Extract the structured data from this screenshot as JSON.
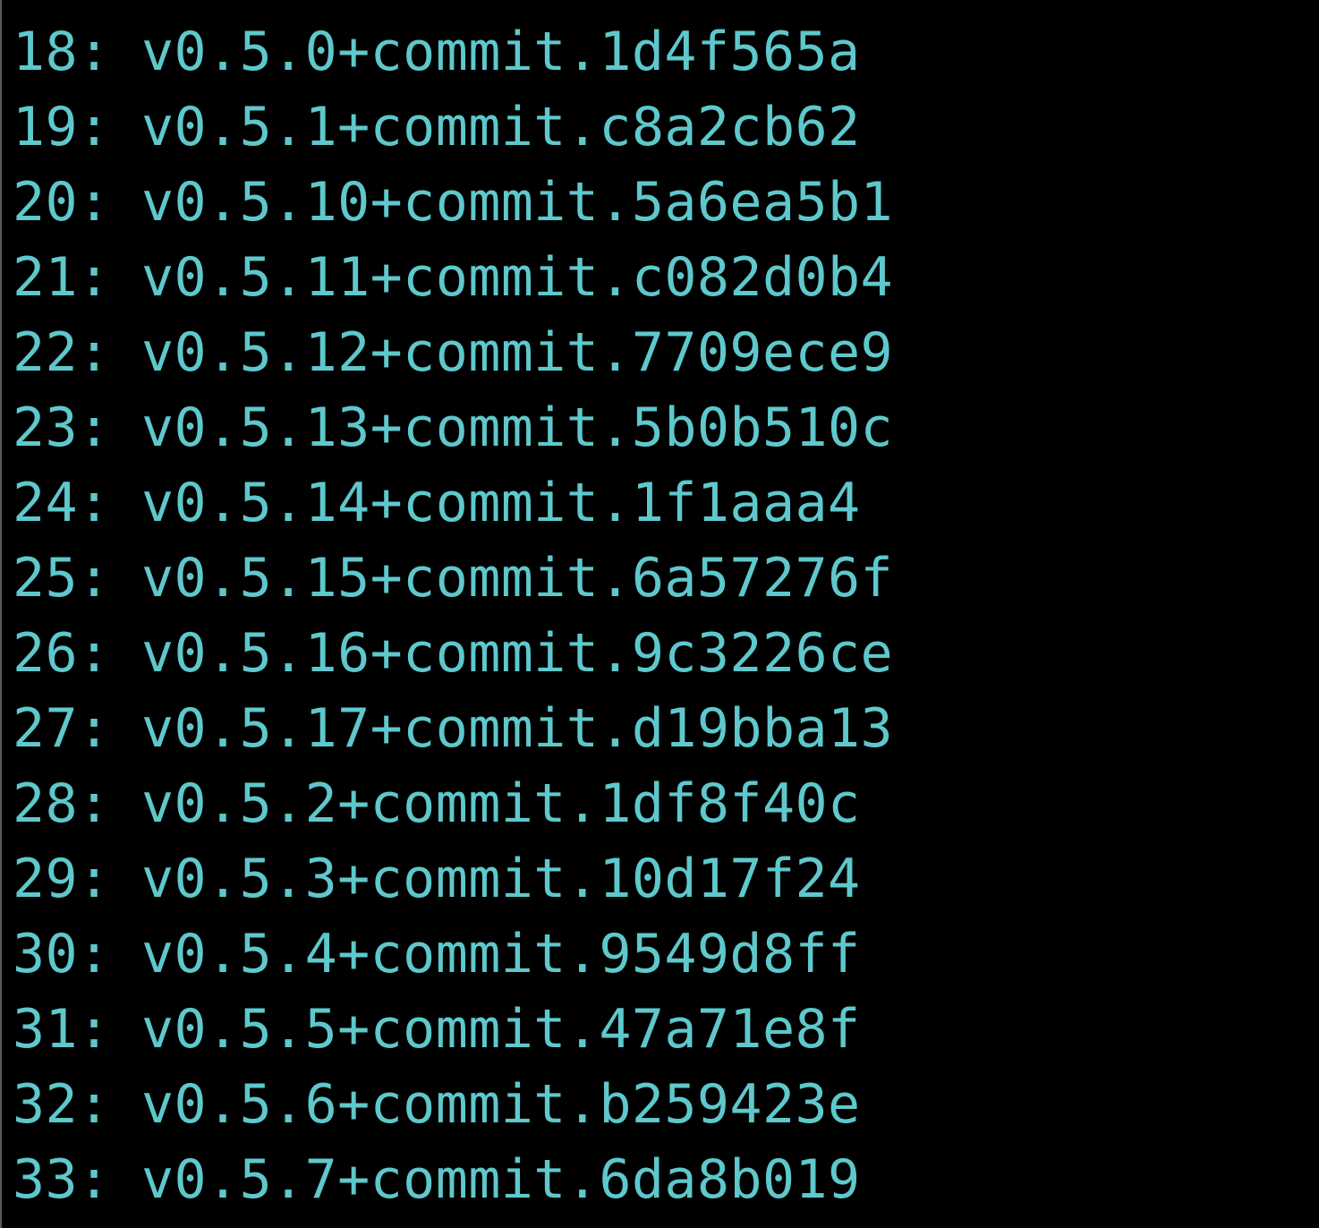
{
  "theme": {
    "text_color": "#5ec8cc",
    "background": "#000000"
  },
  "lines": [
    {
      "number": "18:",
      "version": "v0.5.0+commit.1d4f565a"
    },
    {
      "number": "19:",
      "version": "v0.5.1+commit.c8a2cb62"
    },
    {
      "number": "20:",
      "version": "v0.5.10+commit.5a6ea5b1"
    },
    {
      "number": "21:",
      "version": "v0.5.11+commit.c082d0b4"
    },
    {
      "number": "22:",
      "version": "v0.5.12+commit.7709ece9"
    },
    {
      "number": "23:",
      "version": "v0.5.13+commit.5b0b510c"
    },
    {
      "number": "24:",
      "version": "v0.5.14+commit.1f1aaa4"
    },
    {
      "number": "25:",
      "version": "v0.5.15+commit.6a57276f"
    },
    {
      "number": "26:",
      "version": "v0.5.16+commit.9c3226ce"
    },
    {
      "number": "27:",
      "version": "v0.5.17+commit.d19bba13"
    },
    {
      "number": "28:",
      "version": "v0.5.2+commit.1df8f40c"
    },
    {
      "number": "29:",
      "version": "v0.5.3+commit.10d17f24"
    },
    {
      "number": "30:",
      "version": "v0.5.4+commit.9549d8ff"
    },
    {
      "number": "31:",
      "version": "v0.5.5+commit.47a71e8f"
    },
    {
      "number": "32:",
      "version": "v0.5.6+commit.b259423e"
    },
    {
      "number": "33:",
      "version": "v0.5.7+commit.6da8b019"
    }
  ]
}
